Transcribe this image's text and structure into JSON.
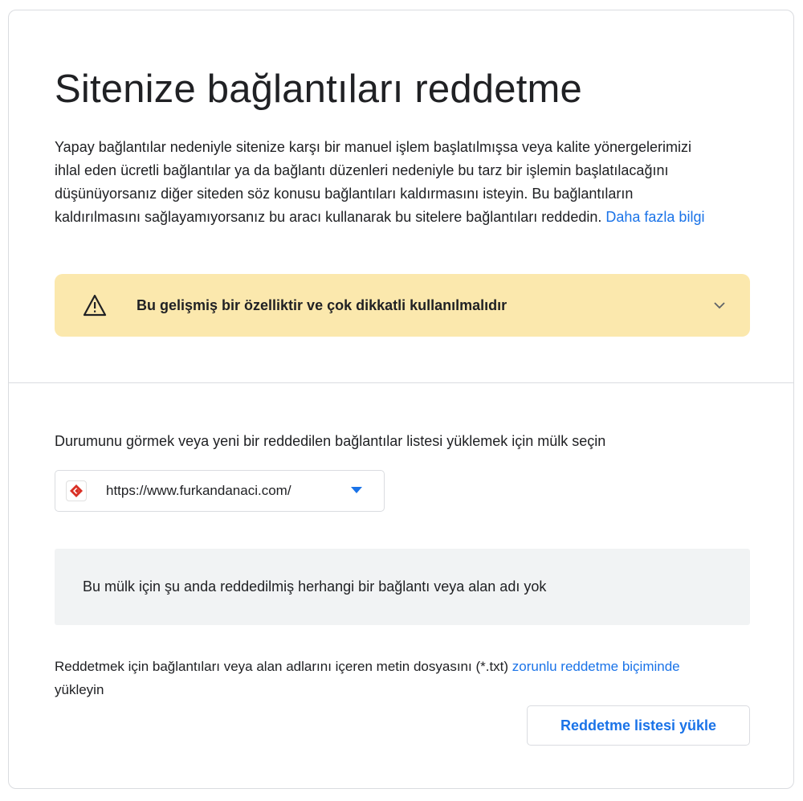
{
  "page": {
    "title": "Sitenize bağlantıları reddetme"
  },
  "intro": {
    "text": "Yapay bağlantılar nedeniyle sitenize karşı bir manuel işlem başlatılmışsa veya kalite yönergelerimizi ihlal eden ücretli bağlantılar ya da bağlantı düzenleri nedeniyle bu tarz bir işlemin başlatılacağını düşünüyorsanız diğer siteden söz konusu bağlantıları kaldırmasını isteyin. Bu bağlantıların kaldırılmasını sağlayamıyorsanız bu aracı kullanarak bu sitelere bağlantıları reddedin.",
    "learn_more_link": "Daha fazla bilgi"
  },
  "warning": {
    "icon": "warning-triangle-icon",
    "text": "Bu gelişmiş bir özelliktir ve çok dikkatli kullanılmalıdır",
    "expand_icon": "chevron-down-icon"
  },
  "property": {
    "prompt": "Durumunu görmek veya yeni bir reddedilen bağlantılar listesi yüklemek için mülk seçin",
    "selected_value": "https://www.furkandanaci.com/",
    "favicon": "site-favicon-icon"
  },
  "status": {
    "empty_message": "Bu mülk için şu anda reddedilmiş herhangi bir bağlantı veya alan adı yok"
  },
  "upload": {
    "description_prefix": "Reddetmek için bağlantıları veya alan adlarını içeren metin dosyasını (*.txt)",
    "format_link": "zorunlu reddetme biçiminde",
    "description_suffix": "yükleyin",
    "button_label": "Reddetme listesi yükle"
  },
  "colors": {
    "accent": "#1a73e8",
    "warning_bg": "#fbe8ad",
    "empty_bg": "#f1f3f4",
    "border": "#dadce0",
    "favicon_red": "#d93025"
  }
}
